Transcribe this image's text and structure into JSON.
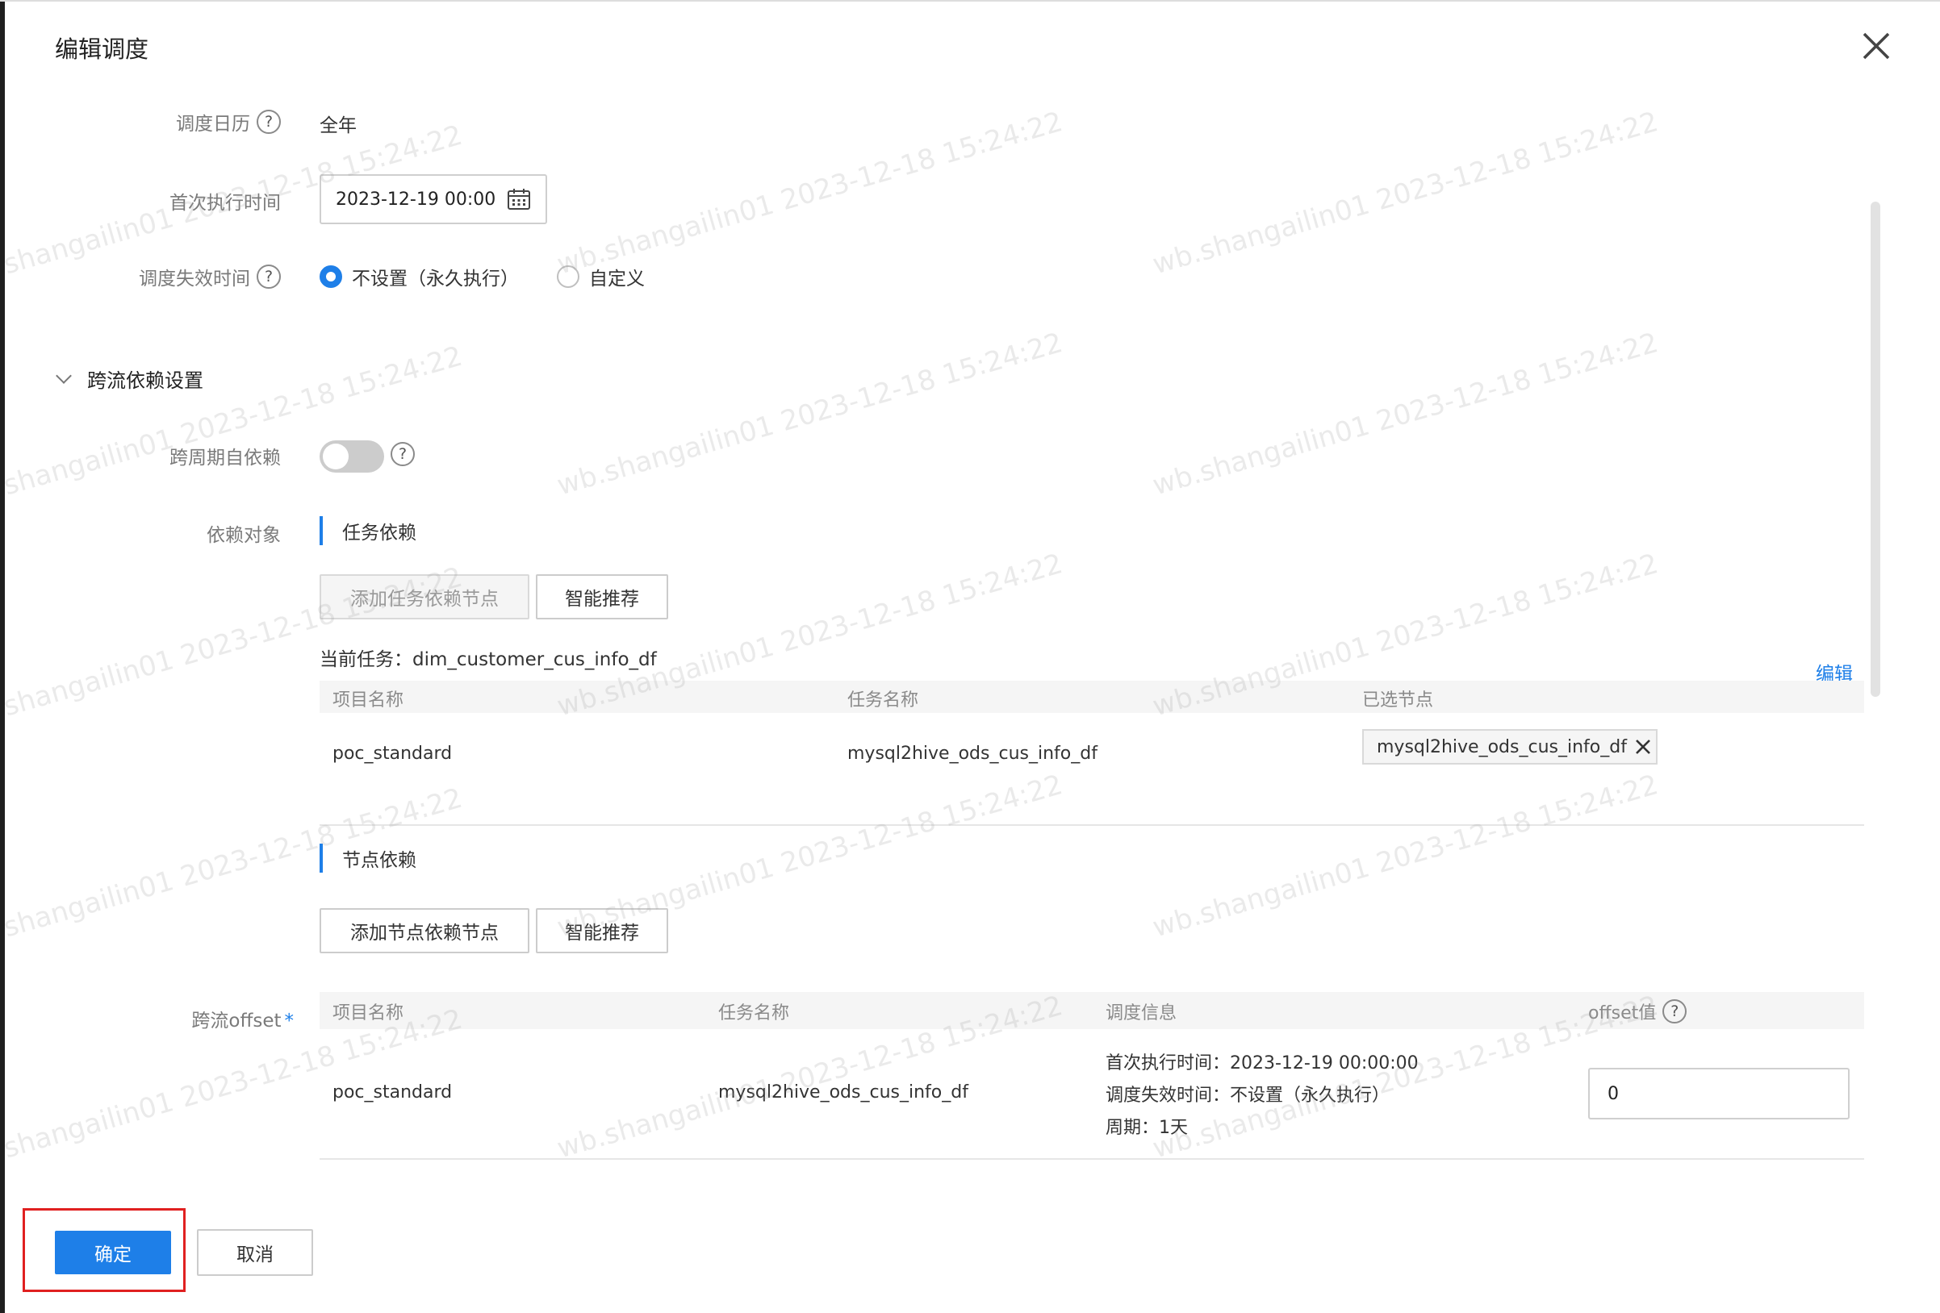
{
  "dialog": {
    "title": "编辑调度"
  },
  "form": {
    "calendar_label": "调度日历",
    "calendar_value": "全年",
    "first_run_label": "首次执行时间",
    "first_run_value": "2023-12-19 00:00",
    "expire_label": "调度失效时间",
    "expire_options": [
      "不设置（永久执行）",
      "自定义"
    ],
    "expire_selected": "不设置（永久执行）"
  },
  "cross_flow": {
    "section_title": "跨流依赖设置",
    "cross_cycle_label": "跨周期自依赖",
    "cross_cycle_enabled": false,
    "dep_object_label": "依赖对象",
    "task_dep_title": "任务依赖",
    "add_task_dep_button": "添加任务依赖节点",
    "smart_recommend_button": "智能推荐",
    "current_task": "当前任务：dim_customer_cus_info_df",
    "edit_link": "编辑",
    "task_table": {
      "headers": [
        "项目名称",
        "任务名称",
        "已选节点"
      ],
      "rows": [
        {
          "project": "poc_standard",
          "task": "mysql2hive_ods_cus_info_df",
          "selected_node": "mysql2hive_ods_cus_info_df"
        }
      ]
    },
    "node_dep_title": "节点依赖",
    "add_node_dep_button": "添加节点依赖节点",
    "smart_recommend_button_2": "智能推荐",
    "offset_label": "跨流offset",
    "offset_required_mark": "*",
    "offset_table": {
      "headers": [
        "项目名称",
        "任务名称",
        "调度信息",
        "offset值"
      ],
      "rows": [
        {
          "project": "poc_standard",
          "task": "mysql2hive_ods_cus_info_df",
          "schedule_lines": [
            "首次执行时间：2023-12-19 00:00:00",
            "调度失效时间：不设置（永久执行）",
            "周期：1天"
          ],
          "offset": "0"
        }
      ]
    }
  },
  "footer": {
    "confirm_button": "确定",
    "cancel_button": "取消"
  },
  "watermark": {
    "text": "wb.shangailin01 2023-12-18 15:24:22",
    "text_left_clipped": "shangailin01 2023-12-18 15:24:22"
  },
  "colors": {
    "accent": "#1e7fe8",
    "highlight": "#e02020"
  }
}
